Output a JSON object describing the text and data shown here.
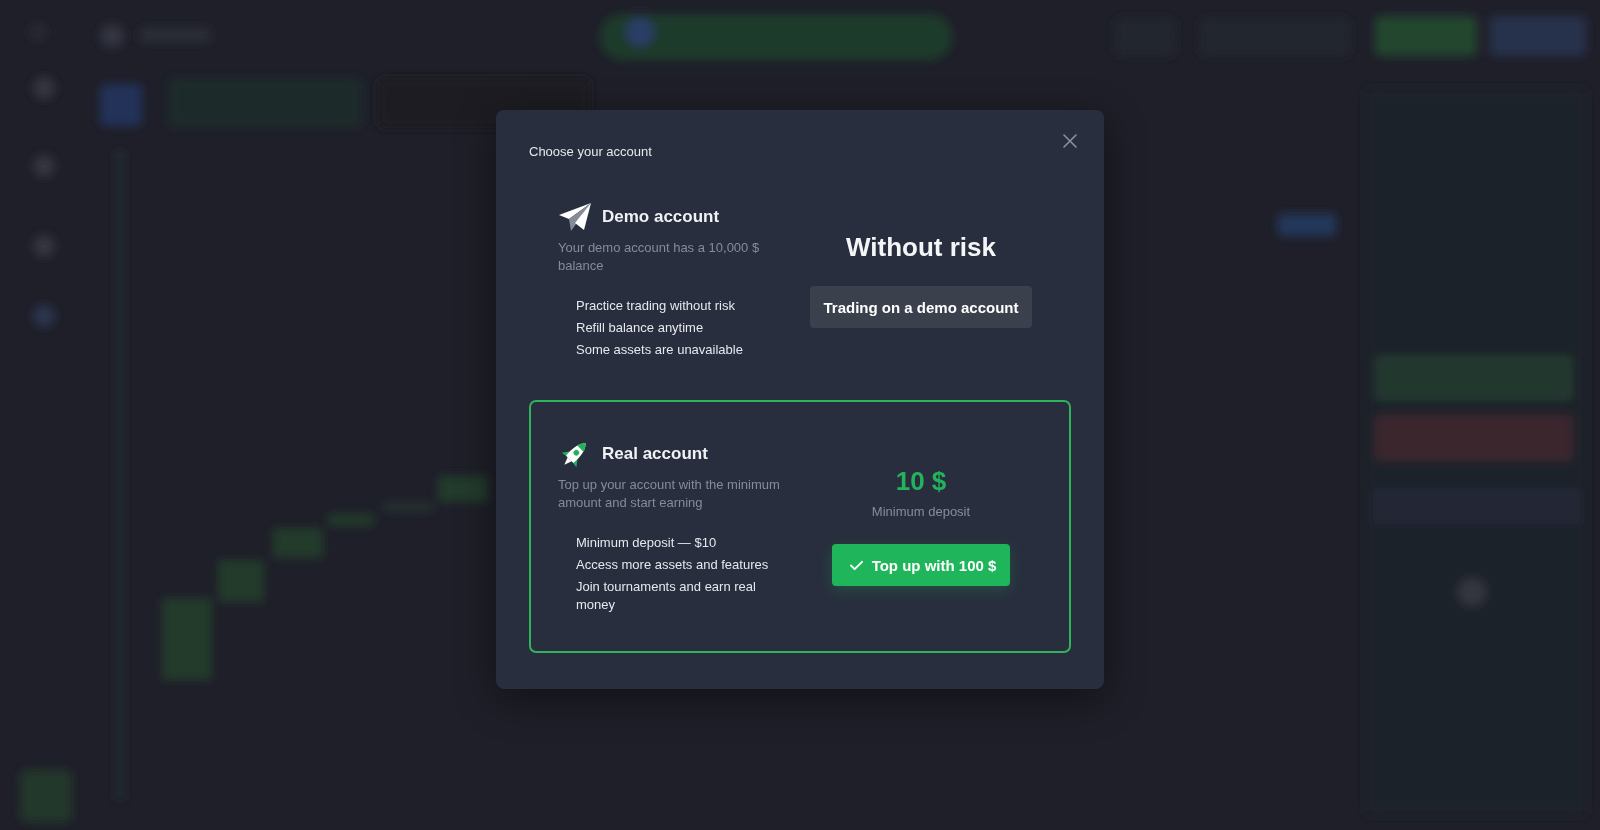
{
  "dialog": {
    "title": "Choose your account",
    "accounts": [
      {
        "kind": "demo",
        "selected": false,
        "name": "Demo account",
        "description": "Your demo account has a 10,000 $ balance",
        "features": [
          "Practice trading without risk",
          "Refill balance anytime",
          "Some assets are unavailable"
        ],
        "headline": "Without risk",
        "button": "Trading on a demo account"
      },
      {
        "kind": "real",
        "selected": true,
        "name": "Real account",
        "description": "Top up your account with the minimum amount and start earning",
        "features": [
          "Minimum deposit — $10",
          "Access more assets and features",
          "Join tournaments and earn real money"
        ],
        "amount": "10 $",
        "amount_caption": "Minimum deposit",
        "button": "Top up with 100 $"
      }
    ]
  }
}
